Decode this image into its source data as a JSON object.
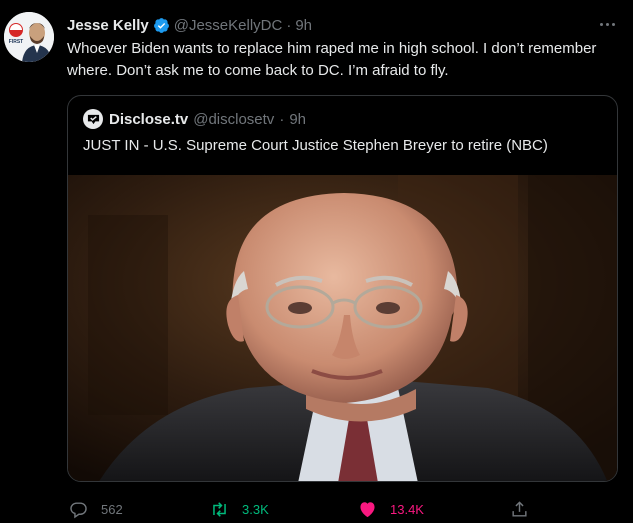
{
  "author": {
    "name": "Jesse Kelly",
    "handle": "@JesseKellyDC",
    "time": "9h",
    "avatar_badge": "FIRST"
  },
  "tweet_text": "Whoever Biden wants to replace him raped me in high school. I don’t remember where. Don’t ask me to come back to DC. I’m afraid to fly.",
  "quoted": {
    "name": "Disclose.tv",
    "handle": "@disclosetv",
    "time": "9h",
    "text": "JUST IN - U.S. Supreme Court Justice Stephen Breyer to retire (NBC)"
  },
  "actions": {
    "replies": "562",
    "retweets": "3.3K",
    "likes": "13.4K"
  },
  "colors": {
    "background": "#000000",
    "text": "#e7e9ea",
    "muted": "#71767b",
    "verified": "#1d9bf0",
    "like": "#f91880",
    "retweet": "#00ba7c",
    "border": "#333639"
  },
  "icons": [
    "verified-badge-icon",
    "more-icon",
    "disclose-logo-icon",
    "reply-icon",
    "retweet-icon",
    "like-icon",
    "share-icon"
  ]
}
